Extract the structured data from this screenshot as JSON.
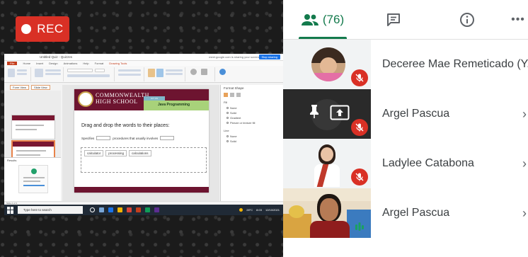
{
  "recording": {
    "label": "REC"
  },
  "shared_screen": {
    "window_title": "Untitled Quiz - Quizzes",
    "share_note": "meet.google.com is sharing your screen",
    "stop_sharing": "Stop sharing",
    "ribbon_tabs": [
      "File",
      "Home",
      "Insert",
      "Design",
      "Animations",
      "Help",
      "Format"
    ],
    "drawing_tab": "Drawing Tools",
    "view_tabs": [
      "Form View",
      "Slide View"
    ],
    "results_label": "Results",
    "slide": {
      "school": [
        "COMMONWEALTH",
        "HIGH SCHOOL"
      ],
      "banner_small": "ICT CS",
      "course": "Java Programming",
      "instruction": "Drag and drop the words to their places:",
      "sentence_start": "Specifies",
      "sentence_mid": "procedures that usually involves",
      "words": [
        "calculator",
        "processing",
        "calculations"
      ]
    },
    "format_pane": {
      "title": "Format Shape",
      "fill_label": "Fill",
      "fill_options": [
        "None",
        "Solid",
        "Gradient",
        "Picture or texture fill"
      ],
      "line_label": "Line",
      "line_options": [
        "None",
        "Solid"
      ]
    },
    "status_text": "Slide 2 of 3",
    "taskbar": {
      "search_placeholder": "Type here to search",
      "temperature": "28°C",
      "time": "8:03",
      "date": "12/10/2021"
    }
  },
  "panel": {
    "people_count": "(76)",
    "accent": "#137a4c",
    "participants": [
      {
        "name": "Deceree Mae Remeticado (Y..."
      },
      {
        "name": "Argel Pascua"
      },
      {
        "name": "Ladylee Catabona"
      },
      {
        "name": "Argel Pascua"
      }
    ],
    "icons": [
      "people-icon",
      "chat-icon",
      "info-icon",
      "more-icon",
      "chevron-right-icon",
      "mic-off-icon",
      "pin-icon",
      "present-icon"
    ]
  }
}
